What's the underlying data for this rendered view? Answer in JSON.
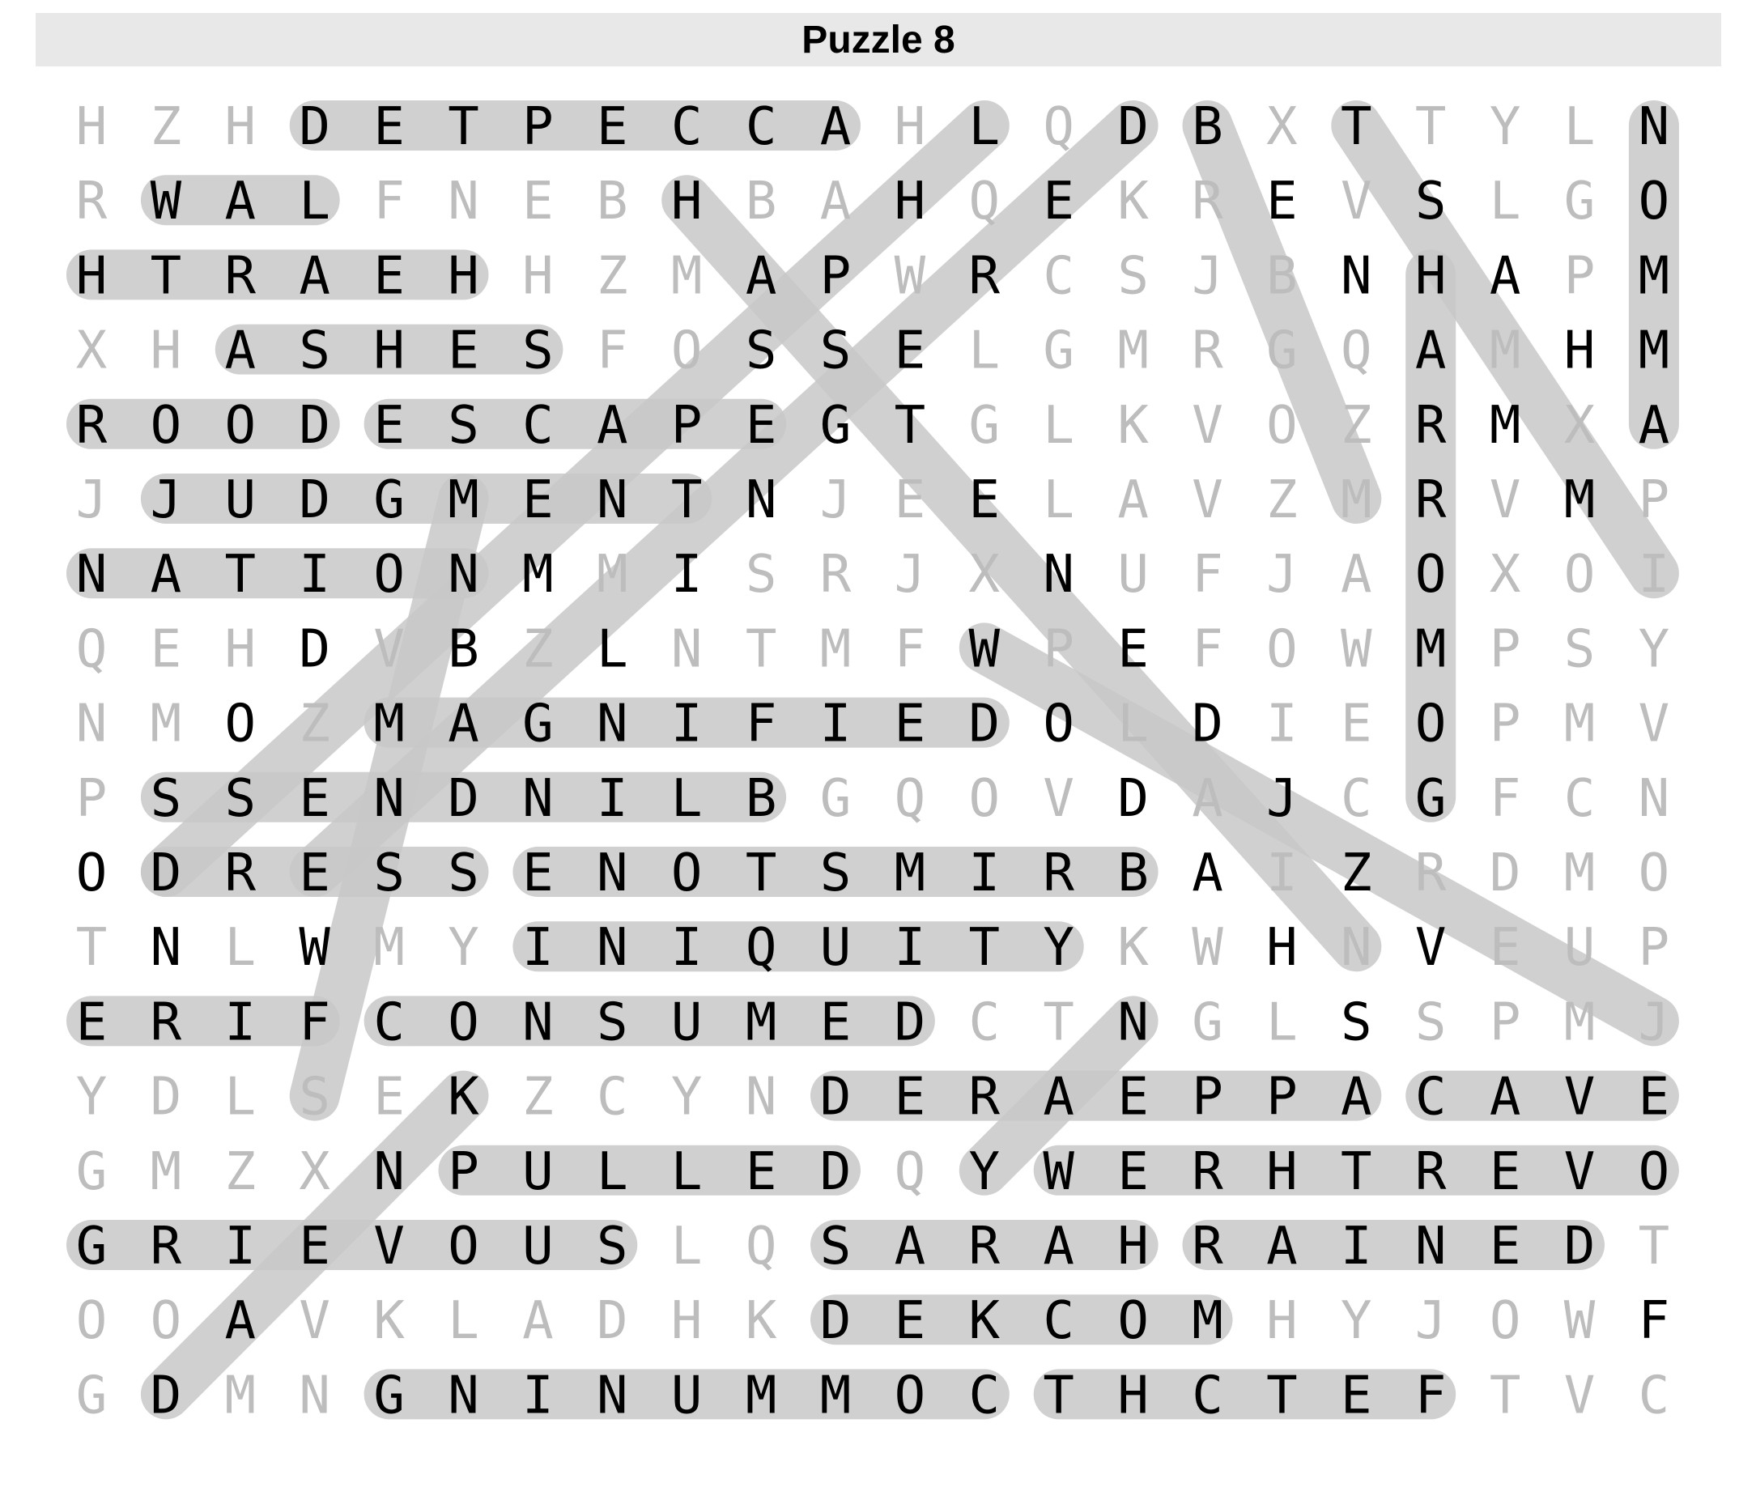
{
  "title": "Puzzle 8",
  "colors": {
    "title_bar": "#e8e8e8",
    "highlight": "#c8c8c8",
    "found_letter": "#000000",
    "unused_letter": "#bdbdbd"
  },
  "grid": [
    "HZHDETPECCAHLQDBXTTYLN",
    "RWALFNEBHBAHQEKREVSLGO",
    "HTRAEHHZMAPWRCSJBNHAPM",
    "XHASHESFOSSELGMRGQAMHM",
    "ROODESCAPEGTGLKVOZRMXA",
    "JJUDGMENTNJEELAVZMRVMP",
    "NATIONMMISRJXNUFJAOXOI",
    "QEHDVBZLNTMFWPEFOWMPSY",
    "NMOZMAGNIFIEDOLDIEOPMV",
    "PSSENDNILBGQOVDAJCGFCN",
    "ODRESSENOTSMIRBAIZRDMO",
    "TNLWMYINIQUITYKWHNVEUP",
    "ERIFCONSUMEDCTNGLSSPMJ",
    "YDLSEKZCYNDERAEPPACAVE",
    "GMZXNPULLEDQYWERHTREVO",
    "GRIEVOUSLQSARAHRAINEDT",
    "OOAVKLADHKDEKCOMHYJOWF",
    "GDMNGNINUMMOCTHCTEFTVC"
  ],
  "found_words": [
    {
      "word": "ACCEPTED",
      "start": [
        0,
        10
      ],
      "end": [
        0,
        3
      ]
    },
    {
      "word": "LAW",
      "start": [
        1,
        3
      ],
      "end": [
        1,
        1
      ]
    },
    {
      "word": "HEARTH",
      "start": [
        2,
        5
      ],
      "end": [
        2,
        0
      ]
    },
    {
      "word": "ASHES",
      "start": [
        3,
        2
      ],
      "end": [
        3,
        6
      ]
    },
    {
      "word": "DOOR",
      "start": [
        4,
        3
      ],
      "end": [
        4,
        0
      ]
    },
    {
      "word": "ESCAPE",
      "start": [
        4,
        4
      ],
      "end": [
        4,
        9
      ]
    },
    {
      "word": "JUDGMENT",
      "start": [
        5,
        1
      ],
      "end": [
        5,
        8
      ]
    },
    {
      "word": "NATION",
      "start": [
        6,
        0
      ],
      "end": [
        6,
        5
      ]
    },
    {
      "word": "MAGNIFIED",
      "start": [
        8,
        4
      ],
      "end": [
        8,
        12
      ]
    },
    {
      "word": "BLINDNESS",
      "start": [
        9,
        9
      ],
      "end": [
        9,
        1
      ]
    },
    {
      "word": "DRESS",
      "start": [
        10,
        1
      ],
      "end": [
        10,
        5
      ]
    },
    {
      "word": "BRIMSTONE",
      "start": [
        10,
        14
      ],
      "end": [
        10,
        6
      ]
    },
    {
      "word": "INIQUITY",
      "start": [
        11,
        6
      ],
      "end": [
        11,
        13
      ]
    },
    {
      "word": "FIRE",
      "start": [
        12,
        3
      ],
      "end": [
        12,
        0
      ]
    },
    {
      "word": "CONSUMED",
      "start": [
        12,
        4
      ],
      "end": [
        12,
        11
      ]
    },
    {
      "word": "APPEARED",
      "start": [
        13,
        17
      ],
      "end": [
        13,
        10
      ]
    },
    {
      "word": "CAVE",
      "start": [
        13,
        18
      ],
      "end": [
        13,
        21
      ]
    },
    {
      "word": "PULLED",
      "start": [
        14,
        5
      ],
      "end": [
        14,
        10
      ]
    },
    {
      "word": "OVERTHREW",
      "start": [
        14,
        21
      ],
      "end": [
        14,
        13
      ]
    },
    {
      "word": "GRIEVOUS",
      "start": [
        15,
        0
      ],
      "end": [
        15,
        7
      ]
    },
    {
      "word": "SARAH",
      "start": [
        15,
        10
      ],
      "end": [
        15,
        14
      ]
    },
    {
      "word": "RAINED",
      "start": [
        15,
        15
      ],
      "end": [
        15,
        20
      ]
    },
    {
      "word": "MOCKED",
      "start": [
        16,
        15
      ],
      "end": [
        16,
        10
      ]
    },
    {
      "word": "COMMUNING",
      "start": [
        17,
        12
      ],
      "end": [
        17,
        4
      ]
    },
    {
      "word": "FETCHT",
      "start": [
        17,
        18
      ],
      "end": [
        17,
        13
      ]
    },
    {
      "word": "GOMORRAH",
      "start": [
        9,
        18
      ],
      "end": [
        2,
        18
      ]
    },
    {
      "word": "NOMMA",
      "start": [
        0,
        21
      ],
      "end": [
        4,
        21
      ]
    },
    {
      "word": "TSHALMI",
      "start": [
        0,
        17
      ],
      "end": [
        6,
        21
      ]
    },
    {
      "word": "BERSERKM",
      "start": [
        0,
        15
      ],
      "end": [
        5,
        17
      ]
    },
    {
      "word": "DESCRIPTION",
      "start": [
        0,
        14
      ],
      "end": [
        10,
        3
      ]
    },
    {
      "word": "HQELLANE",
      "start": [
        1,
        8
      ],
      "end": [
        11,
        17
      ]
    },
    {
      "word": "WPMJ",
      "start": [
        7,
        12
      ],
      "end": [
        12,
        21
      ]
    },
    {
      "word": "LEG",
      "start": [
        0,
        12
      ],
      "end": [
        10,
        1
      ]
    },
    {
      "word": "MODEST",
      "start": [
        5,
        5
      ],
      "end": [
        13,
        3
      ]
    },
    {
      "word": "KNS",
      "start": [
        13,
        5
      ],
      "end": [
        17,
        1
      ]
    },
    {
      "word": "YN",
      "start": [
        14,
        12
      ],
      "end": [
        12,
        14
      ]
    }
  ]
}
